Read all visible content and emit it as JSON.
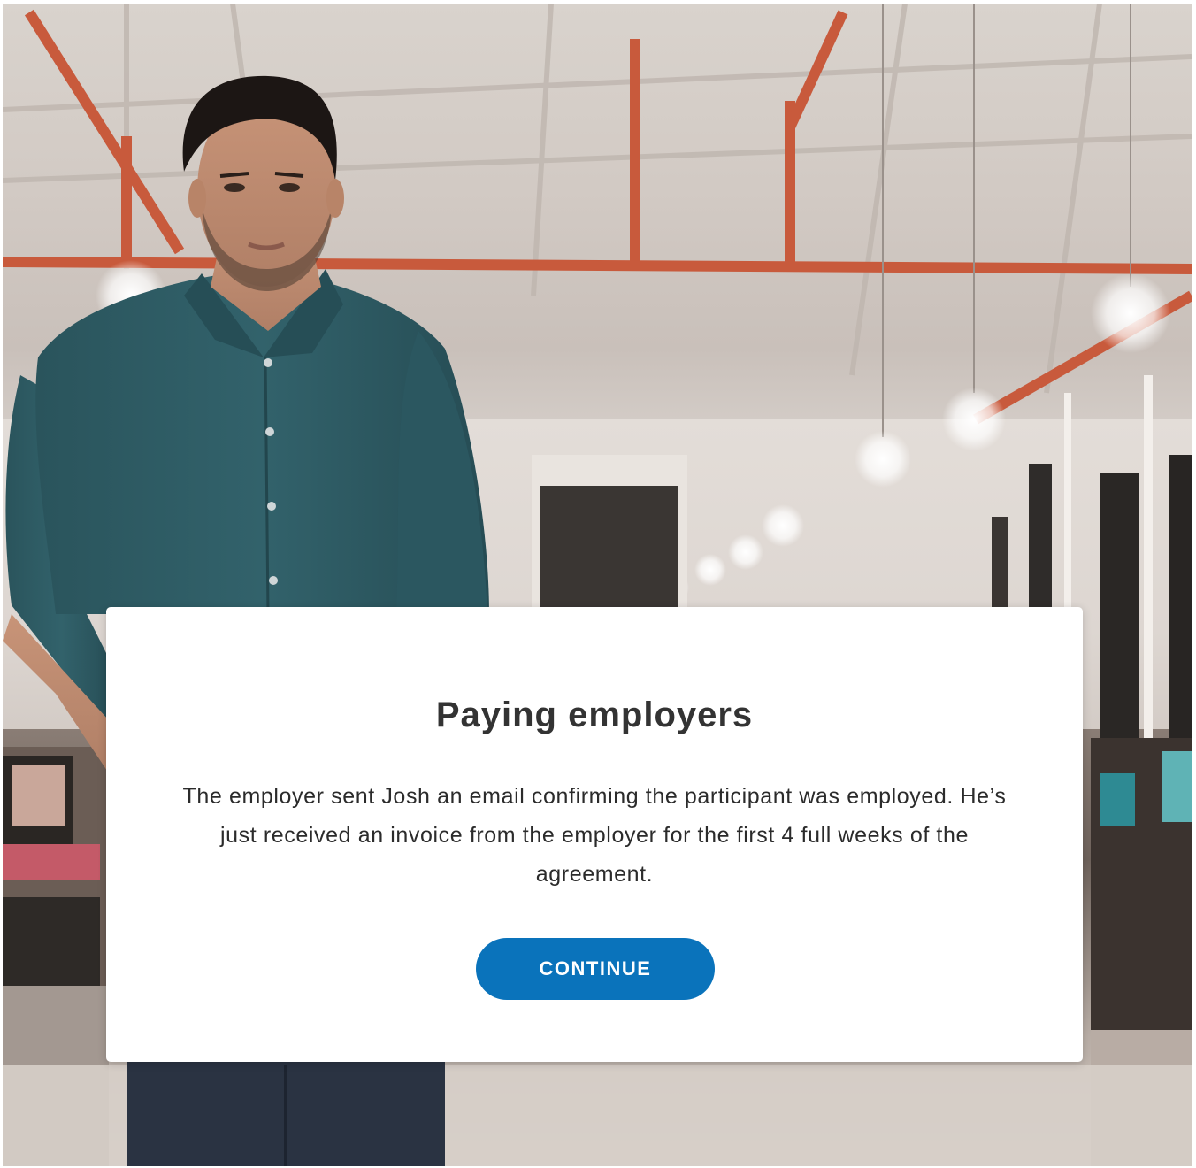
{
  "dialog": {
    "title": "Paying employers",
    "body": "The employer sent Josh an email confirming the participant was employed. He’s just received an invoice from the employer for the first 4 full weeks of the agreement.",
    "button_label": "CONTINUE"
  },
  "colors": {
    "button": "#0a73bb",
    "title": "#333333",
    "shirt": "#2e5a63",
    "ceiling_pipe": "#c85a3c"
  }
}
